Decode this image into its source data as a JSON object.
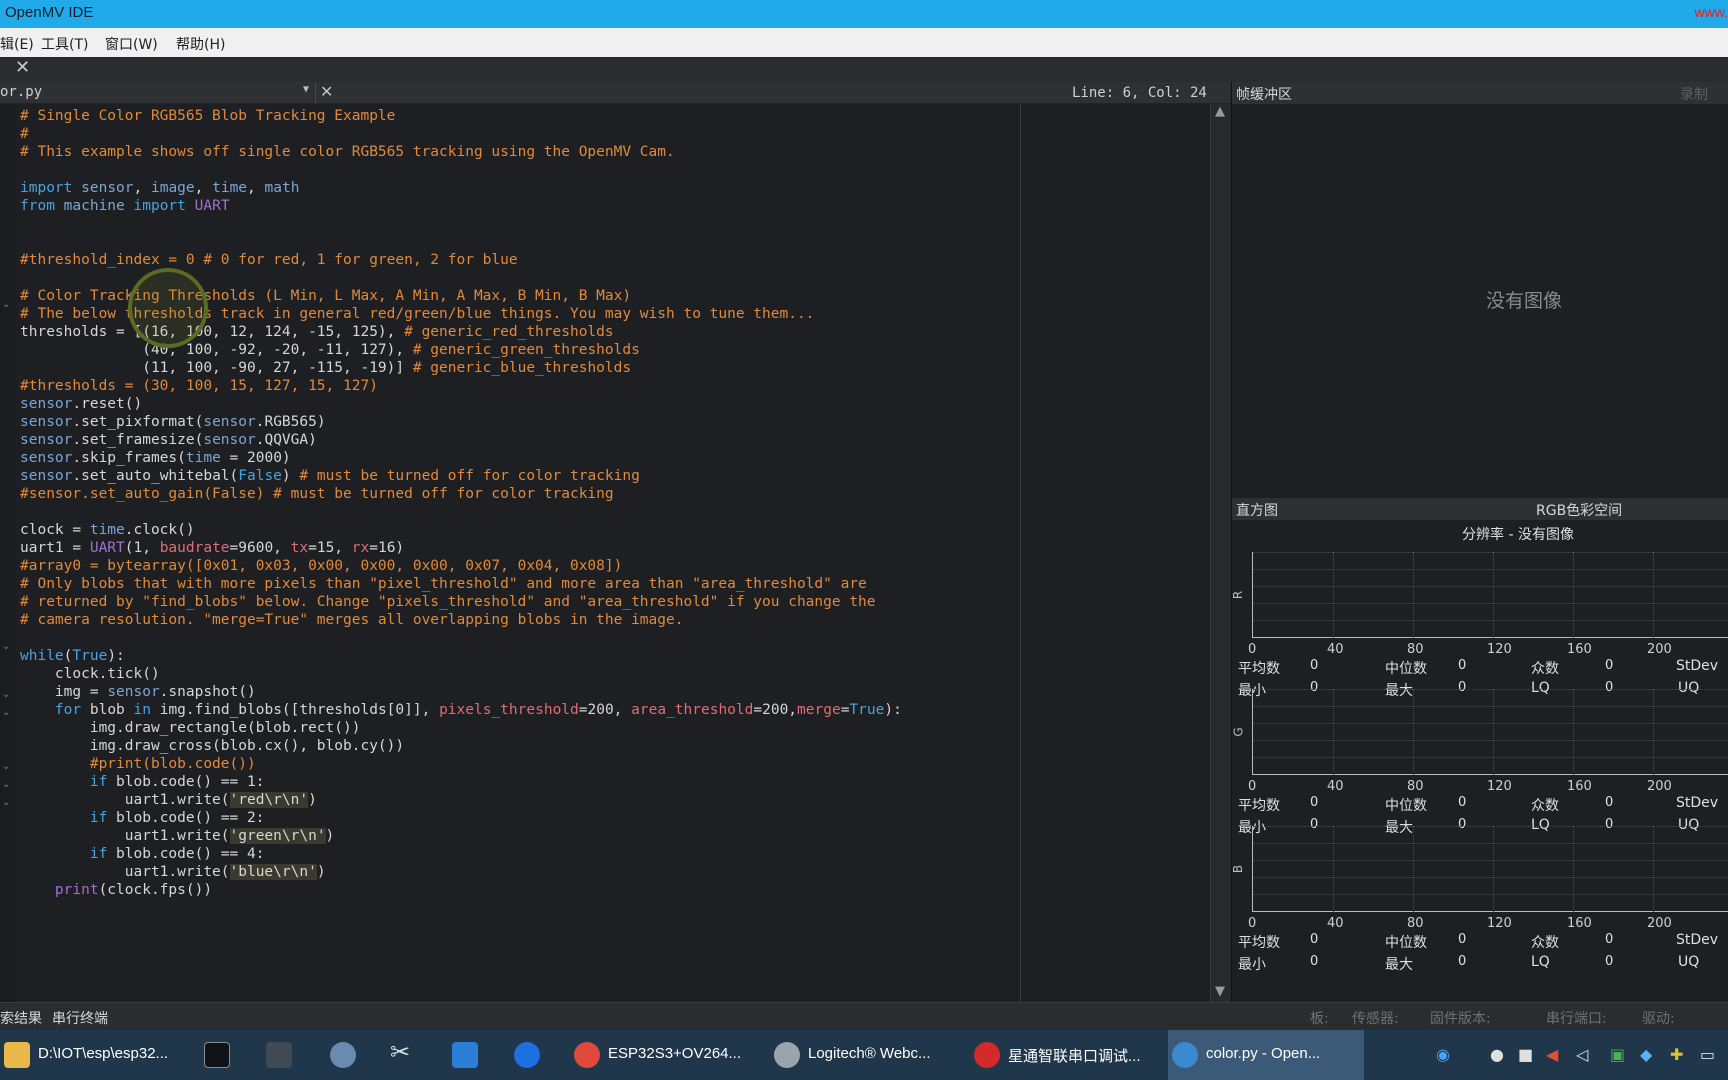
{
  "window": {
    "title": "OpenMV IDE",
    "corner_text": "www."
  },
  "menu": [
    {
      "label": "辑(E)"
    },
    {
      "label": "工具(T)"
    },
    {
      "label": "窗口(W)"
    },
    {
      "label": "帮助(H)"
    }
  ],
  "editor": {
    "file_name": "or.py",
    "line_col": "Line: 6, Col: 24",
    "code_lines": [
      "# Single Color RGB565 Blob Tracking Example",
      "#",
      "# This example shows off single color RGB565 tracking using the OpenMV Cam.",
      "",
      "import sensor, image, time, math",
      "from machine import UART",
      "",
      "",
      "#threshold_index = 0 # 0 for red, 1 for green, 2 for blue",
      "",
      "# Color Tracking Thresholds (L Min, L Max, A Min, A Max, B Min, B Max)",
      "# The below thresholds track in general red/green/blue things. You may wish to tune them...",
      "thresholds = [(16, 100, 12, 124, -15, 125), # generic_red_thresholds",
      "              (40, 100, -92, -20, -11, 127), # generic_green_thresholds",
      "              (11, 100, -90, 27, -115, -19)] # generic_blue_thresholds",
      "#thresholds = (30, 100, 15, 127, 15, 127)",
      "sensor.reset()",
      "sensor.set_pixformat(sensor.RGB565)",
      "sensor.set_framesize(sensor.QQVGA)",
      "sensor.skip_frames(time = 2000)",
      "sensor.set_auto_whitebal(False) # must be turned off for color tracking",
      "#sensor.set_auto_gain(False) # must be turned off for color tracking",
      "",
      "clock = time.clock()",
      "uart1 = UART(1, baudrate=9600, tx=15, rx=16)",
      "#array0 = bytearray([0x01, 0x03, 0x00, 0x00, 0x00, 0x07, 0x04, 0x08])",
      "# Only blobs that with more pixels than \"pixel_threshold\" and more area than \"area_threshold\" are",
      "# returned by \"find_blobs\" below. Change \"pixels_threshold\" and \"area_threshold\" if you change the",
      "# camera resolution. \"merge=True\" merges all overlapping blobs in the image.",
      "",
      "while(True):",
      "    clock.tick()",
      "    img = sensor.snapshot()",
      "    for blob in img.find_blobs([thresholds[0]], pixels_threshold=200, area_threshold=200,merge=True):",
      "        img.draw_rectangle(blob.rect())",
      "        img.draw_cross(blob.cx(), blob.cy())",
      "        #print(blob.code())",
      "        if blob.code() == 1:",
      "            uart1.write('red\\r\\n')",
      "        if blob.code() == 2:",
      "            uart1.write('green\\r\\n')",
      "        if blob.code() == 4:",
      "            uart1.write('blue\\r\\n')",
      "    print(clock.fps())"
    ]
  },
  "frame_buffer": {
    "title": "帧缓冲区",
    "record_label": "录制",
    "no_image": "没有图像"
  },
  "histogram": {
    "title": "直方图",
    "color_space": "RGB色彩空间",
    "resolution": "分辨率 - 没有图像",
    "channels": [
      "R",
      "G",
      "B"
    ],
    "ticks": [
      "0",
      "40",
      "80",
      "120",
      "160",
      "200"
    ],
    "stats": {
      "mean_label": "平均数",
      "mean": "0",
      "median_label": "中位数",
      "median": "0",
      "mode_label": "众数",
      "mode": "0",
      "stdev_label": "StDev",
      "min_label": "最小",
      "min": "0",
      "max_label": "最大",
      "max": "0",
      "lq_label": "LQ",
      "lq": "0",
      "uq_label": "UQ"
    }
  },
  "bottom_tabs": [
    {
      "label": "索结果"
    },
    {
      "label": "串行终端"
    }
  ],
  "status": {
    "board": "板:",
    "sensor": "传感器:",
    "firmware": "固件版本:",
    "port": "串行端口:",
    "driver": "驱动:"
  },
  "taskbar": [
    {
      "label": "D:\\IOT\\esp\\esp32..."
    },
    {
      "label": ""
    },
    {
      "label": ""
    },
    {
      "label": ""
    },
    {
      "label": ""
    },
    {
      "label": ""
    },
    {
      "label": ""
    },
    {
      "label": "ESP32S3+OV264..."
    },
    {
      "label": "Logitech® Webc..."
    },
    {
      "label": "星通智联串口调试..."
    },
    {
      "label": "color.py - Open..."
    }
  ],
  "colors": {
    "titlebar": "#21aaea",
    "editor_bg": "#1e1f22",
    "comment": "#e08a3c",
    "keyword": "#4aa3df",
    "taskbar": "#20364a"
  }
}
